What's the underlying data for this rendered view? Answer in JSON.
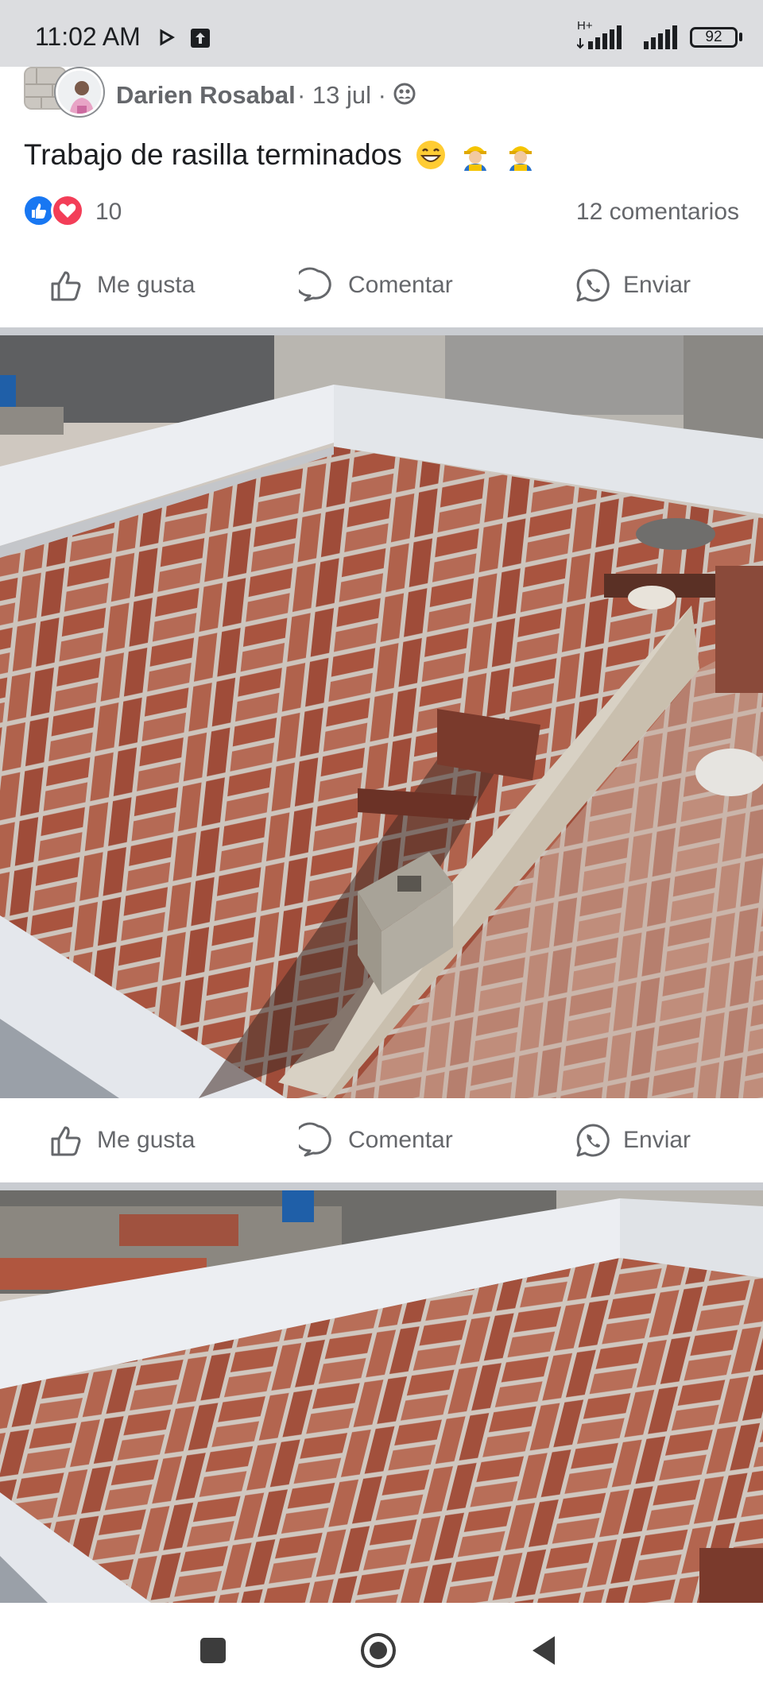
{
  "status_bar": {
    "time": "11:02 AM",
    "network_label": "H+",
    "battery": "92",
    "icons": [
      "play-icon",
      "upload-icon",
      "signal-icon",
      "battery-icon"
    ]
  },
  "post": {
    "author": "Darien Rosabal",
    "meta": "· 13 jul ·",
    "privacy_icon": "friends-icon",
    "text": "Trabajo de rasilla terminados",
    "text_emojis": [
      "grinning-emoji",
      "construction-worker-emoji",
      "construction-worker-emoji"
    ],
    "reaction_count": "10",
    "comments": "12 comentarios"
  },
  "actions": {
    "like": "Me gusta",
    "comment": "Comentar",
    "send": "Enviar"
  },
  "photos": [
    {
      "description_icon": "rooftop-photo-1"
    },
    {
      "description_icon": "rooftop-photo-2"
    }
  ],
  "colors": {
    "status_bg": "#dcdde0",
    "text_secondary": "#65676b",
    "like_blue": "#1877f2",
    "love_red": "#f33e58",
    "brick": "#a5533f",
    "mortar": "#cfc6bd"
  }
}
